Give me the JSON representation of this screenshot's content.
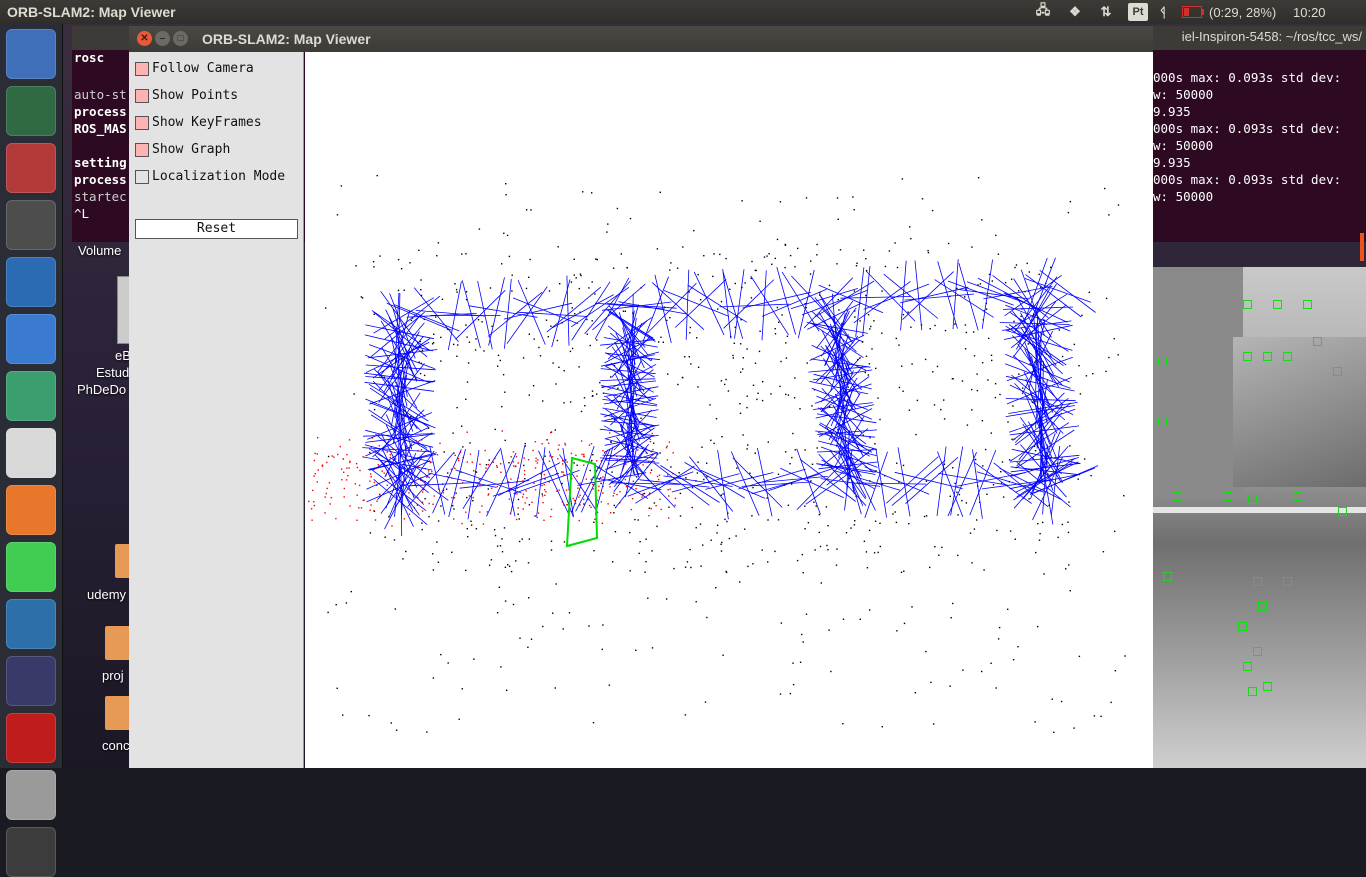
{
  "top_panel": {
    "app_title": "ORB-SLAM2: Map Viewer",
    "pt_label": "Pt",
    "battery_text": "(0:29, 28%)",
    "clock": "10:20",
    "battery_color": "#d0312d"
  },
  "launcher": {
    "icons": [
      {
        "name": "ubuntu-dash-icon",
        "color": "#3e6fb8"
      },
      {
        "name": "camera-app-icon",
        "color": "#2f6a44"
      },
      {
        "name": "files-icon",
        "color": "#b33a3a"
      },
      {
        "name": "sublime-text-icon",
        "color": "#4d4d4d"
      },
      {
        "name": "vscode-icon",
        "color": "#2b6bb3"
      },
      {
        "name": "simplenote-icon",
        "color": "#3a7ad0"
      },
      {
        "name": "atom-icon",
        "color": "#3a9e6e"
      },
      {
        "name": "chrome-icon",
        "color": "#d9d9d9"
      },
      {
        "name": "firefox-icon",
        "color": "#e8762b"
      },
      {
        "name": "qt-icon",
        "color": "#41cd52"
      },
      {
        "name": "mysql-workbench-icon",
        "color": "#2d6fa8"
      },
      {
        "name": "eclipse-icon",
        "color": "#3a3a6a"
      },
      {
        "name": "filezilla-icon",
        "color": "#bf1c1c"
      },
      {
        "name": "system-monitor-icon",
        "color": "#9a9a9a"
      },
      {
        "name": "terminal-icon",
        "color": "#3c3c3c"
      }
    ]
  },
  "desktop": {
    "labels": [
      "Volume",
      "eB",
      "Estud",
      "PhDeDo",
      "udemy",
      "proj",
      "conc"
    ]
  },
  "terminal": {
    "title": "iel-Inspiron-5458: ~/ros/tcc_ws/",
    "left_lines": [
      "rosc",
      "",
      "auto-st",
      "process",
      "ROS_MAS",
      "",
      "setting",
      "process",
      "startec",
      "^L"
    ],
    "right_lines": [
      "000s max: 0.093s std dev:",
      "w: 50000",
      "9.935",
      "000s max: 0.093s std dev:",
      "w: 50000",
      "9.935",
      "000s max: 0.093s std dev:",
      "w: 50000"
    ]
  },
  "viewer": {
    "title": "ORB-SLAM2: Map Viewer",
    "options": [
      {
        "label": "Follow Camera",
        "checked": true
      },
      {
        "label": "Show Points",
        "checked": true
      },
      {
        "label": "Show KeyFrames",
        "checked": true
      },
      {
        "label": "Show Graph",
        "checked": true
      },
      {
        "label": "Localization Mode",
        "checked": false
      }
    ],
    "reset_label": "Reset"
  },
  "map": {
    "keyframe_color": "#0000ff",
    "point_color": "#000000",
    "reference_point_color": "#ff0000",
    "current_camera_color": "#00dd00"
  }
}
